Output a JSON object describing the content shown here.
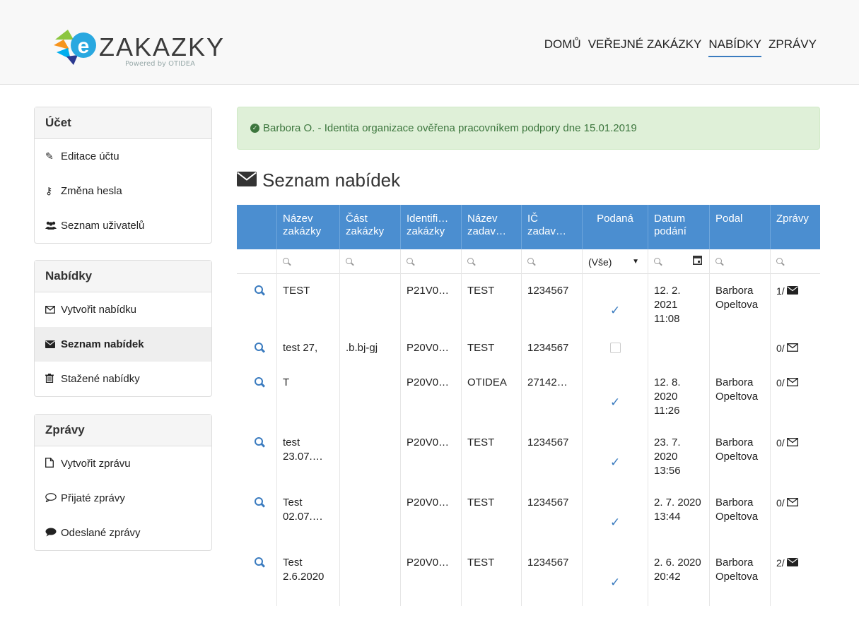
{
  "header": {
    "logo_text": "ZAKAZKY",
    "logo_powered": "Powered by OTIDEA",
    "nav": [
      "DOMŮ",
      "VEŘEJNÉ ZAKÁZKY",
      "NABÍDKY",
      "ZPRÁVY"
    ],
    "nav_active": "NABÍDKY"
  },
  "sidebar": {
    "ucet": {
      "title": "Účet",
      "items": [
        {
          "label": "Editace účtu",
          "icon": "edit-icon"
        },
        {
          "label": "Změna hesla",
          "icon": "key-icon"
        },
        {
          "label": "Seznam uživatelů",
          "icon": "users-icon"
        }
      ]
    },
    "nabidky": {
      "title": "Nabídky",
      "items": [
        {
          "label": "Vytvořit nabídku",
          "icon": "envelope-outline-icon"
        },
        {
          "label": "Seznam nabídek",
          "icon": "envelope-icon",
          "active": true
        },
        {
          "label": "Stažené nabídky",
          "icon": "trash-icon"
        }
      ]
    },
    "zpravy": {
      "title": "Zprávy",
      "items": [
        {
          "label": "Vytvořit zprávu",
          "icon": "file-icon"
        },
        {
          "label": "Přijaté zprávy",
          "icon": "comment-outline-icon"
        },
        {
          "label": "Odeslané zprávy",
          "icon": "comment-icon"
        }
      ]
    }
  },
  "alert": {
    "text": "Barbora O. - Identita organizace ověřena pracovníkem podpory dne 15.01.2019"
  },
  "page_title": "Seznam nabídek",
  "table": {
    "columns": [
      "",
      "Název zakázky",
      "Část zakázky",
      "Identifi… zakázky",
      "Název zadav…",
      "IČ zadav…",
      "Podaná",
      "Datum podání",
      "Podal",
      "Zprávy"
    ],
    "filter_select": "(Vše)",
    "rows": [
      {
        "nazev": "TEST",
        "cast": "",
        "ident": "P21V0…",
        "zadav": "TEST",
        "ic": "1234567",
        "podana": true,
        "datum": "12. 2. 2021 11:08",
        "podal": "Barbora Opeltova",
        "zpravy": "1/",
        "msg_filled": true
      },
      {
        "nazev": "test 27,",
        "cast": ".b.bj-gj",
        "ident": "P20V0…",
        "zadav": "TEST",
        "ic": "1234567",
        "podana": false,
        "datum": "",
        "podal": "",
        "zpravy": "0/",
        "msg_filled": false
      },
      {
        "nazev": "T",
        "cast": "",
        "ident": "P20V0…",
        "zadav": "OTIDEA",
        "ic": "27142…",
        "podana": true,
        "datum": "12. 8. 2020 11:26",
        "podal": "Barbora Opeltova",
        "zpravy": "0/",
        "msg_filled": false
      },
      {
        "nazev": "test 23.07.…",
        "cast": "",
        "ident": "P20V0…",
        "zadav": "TEST",
        "ic": "1234567",
        "podana": true,
        "datum": "23. 7. 2020 13:56",
        "podal": "Barbora Opeltova",
        "zpravy": "0/",
        "msg_filled": false
      },
      {
        "nazev": "Test 02.07.…",
        "cast": "",
        "ident": "P20V0…",
        "zadav": "TEST",
        "ic": "1234567",
        "podana": true,
        "datum": "2. 7. 2020 13:44",
        "podal": "Barbora Opeltova",
        "zpravy": "0/",
        "msg_filled": false
      },
      {
        "nazev": "Test 2.6.2020",
        "cast": "",
        "ident": "P20V0…",
        "zadav": "TEST",
        "ic": "1234567",
        "podana": true,
        "datum": "2. 6. 2020 20:42",
        "podal": "Barbora Opeltova",
        "zpravy": "2/",
        "msg_filled": true
      }
    ]
  },
  "colors": {
    "header_bg": "#4b8ed0",
    "accent": "#3a7bbf",
    "alert_bg": "#dff0d8",
    "alert_text": "#3c763d"
  }
}
